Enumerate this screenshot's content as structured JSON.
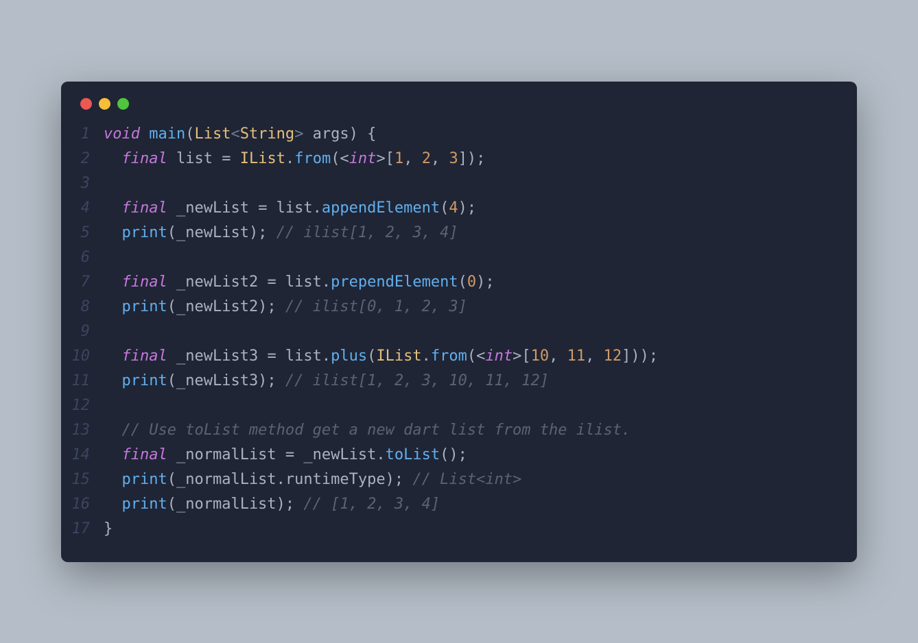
{
  "traffic_lights": {
    "red": "#ed5754",
    "yellow": "#f5bf3a",
    "green": "#4fc53e"
  },
  "code": {
    "lines": [
      {
        "n": "1",
        "tokens": [
          {
            "c": "kw-void",
            "t": "void"
          },
          {
            "c": "punct",
            "t": " "
          },
          {
            "c": "fn-main",
            "t": "main"
          },
          {
            "c": "punct",
            "t": "("
          },
          {
            "c": "type",
            "t": "List"
          },
          {
            "c": "punct-dim",
            "t": "<"
          },
          {
            "c": "type",
            "t": "String"
          },
          {
            "c": "punct-dim",
            "t": ">"
          },
          {
            "c": "ident",
            "t": " args"
          },
          {
            "c": "punct",
            "t": ") {"
          }
        ]
      },
      {
        "n": "2",
        "tokens": [
          {
            "c": "punct",
            "t": "  "
          },
          {
            "c": "kw-final",
            "t": "final"
          },
          {
            "c": "ident",
            "t": " list "
          },
          {
            "c": "punct",
            "t": "="
          },
          {
            "c": "ident",
            "t": " "
          },
          {
            "c": "type",
            "t": "IList"
          },
          {
            "c": "punct",
            "t": "."
          },
          {
            "c": "method",
            "t": "from"
          },
          {
            "c": "punct",
            "t": "(<"
          },
          {
            "c": "kw-int",
            "t": "int"
          },
          {
            "c": "punct",
            "t": ">["
          },
          {
            "c": "num",
            "t": "1"
          },
          {
            "c": "punct",
            "t": ", "
          },
          {
            "c": "num",
            "t": "2"
          },
          {
            "c": "punct",
            "t": ", "
          },
          {
            "c": "num",
            "t": "3"
          },
          {
            "c": "punct",
            "t": "]);"
          }
        ]
      },
      {
        "n": "3",
        "tokens": []
      },
      {
        "n": "4",
        "tokens": [
          {
            "c": "punct",
            "t": "  "
          },
          {
            "c": "kw-final",
            "t": "final"
          },
          {
            "c": "ident",
            "t": " _newList "
          },
          {
            "c": "punct",
            "t": "="
          },
          {
            "c": "ident",
            "t": " list."
          },
          {
            "c": "method",
            "t": "appendElement"
          },
          {
            "c": "punct",
            "t": "("
          },
          {
            "c": "num",
            "t": "4"
          },
          {
            "c": "punct",
            "t": ");"
          }
        ]
      },
      {
        "n": "5",
        "tokens": [
          {
            "c": "punct",
            "t": "  "
          },
          {
            "c": "call",
            "t": "print"
          },
          {
            "c": "punct",
            "t": "(_newList); "
          },
          {
            "c": "comment",
            "t": "// ilist[1, 2, 3, 4]"
          }
        ]
      },
      {
        "n": "6",
        "tokens": []
      },
      {
        "n": "7",
        "tokens": [
          {
            "c": "punct",
            "t": "  "
          },
          {
            "c": "kw-final",
            "t": "final"
          },
          {
            "c": "ident",
            "t": " _newList2 "
          },
          {
            "c": "punct",
            "t": "="
          },
          {
            "c": "ident",
            "t": " list."
          },
          {
            "c": "method",
            "t": "prependElement"
          },
          {
            "c": "punct",
            "t": "("
          },
          {
            "c": "num",
            "t": "0"
          },
          {
            "c": "punct",
            "t": ");"
          }
        ]
      },
      {
        "n": "8",
        "tokens": [
          {
            "c": "punct",
            "t": "  "
          },
          {
            "c": "call",
            "t": "print"
          },
          {
            "c": "punct",
            "t": "(_newList2); "
          },
          {
            "c": "comment",
            "t": "// ilist[0, 1, 2, 3]"
          }
        ]
      },
      {
        "n": "9",
        "tokens": []
      },
      {
        "n": "10",
        "tokens": [
          {
            "c": "punct",
            "t": "  "
          },
          {
            "c": "kw-final",
            "t": "final"
          },
          {
            "c": "ident",
            "t": " _newList3 "
          },
          {
            "c": "punct",
            "t": "="
          },
          {
            "c": "ident",
            "t": " list."
          },
          {
            "c": "method",
            "t": "plus"
          },
          {
            "c": "punct",
            "t": "("
          },
          {
            "c": "type",
            "t": "IList"
          },
          {
            "c": "punct",
            "t": "."
          },
          {
            "c": "method",
            "t": "from"
          },
          {
            "c": "punct",
            "t": "(<"
          },
          {
            "c": "kw-int",
            "t": "int"
          },
          {
            "c": "punct",
            "t": ">["
          },
          {
            "c": "num",
            "t": "10"
          },
          {
            "c": "punct",
            "t": ", "
          },
          {
            "c": "num",
            "t": "11"
          },
          {
            "c": "punct",
            "t": ", "
          },
          {
            "c": "num",
            "t": "12"
          },
          {
            "c": "punct",
            "t": "]));"
          }
        ]
      },
      {
        "n": "11",
        "tokens": [
          {
            "c": "punct",
            "t": "  "
          },
          {
            "c": "call",
            "t": "print"
          },
          {
            "c": "punct",
            "t": "(_newList3); "
          },
          {
            "c": "comment",
            "t": "// ilist[1, 2, 3, 10, 11, 12]"
          }
        ]
      },
      {
        "n": "12",
        "tokens": []
      },
      {
        "n": "13",
        "tokens": [
          {
            "c": "punct",
            "t": "  "
          },
          {
            "c": "comment",
            "t": "// Use toList method get a new dart list from the ilist."
          }
        ]
      },
      {
        "n": "14",
        "tokens": [
          {
            "c": "punct",
            "t": "  "
          },
          {
            "c": "kw-final",
            "t": "final"
          },
          {
            "c": "ident",
            "t": " _normalList "
          },
          {
            "c": "punct",
            "t": "="
          },
          {
            "c": "ident",
            "t": " _newList."
          },
          {
            "c": "method",
            "t": "toList"
          },
          {
            "c": "punct",
            "t": "();"
          }
        ]
      },
      {
        "n": "15",
        "tokens": [
          {
            "c": "punct",
            "t": "  "
          },
          {
            "c": "call",
            "t": "print"
          },
          {
            "c": "punct",
            "t": "(_normalList.runtimeType); "
          },
          {
            "c": "comment",
            "t": "// List<int>"
          }
        ]
      },
      {
        "n": "16",
        "tokens": [
          {
            "c": "punct",
            "t": "  "
          },
          {
            "c": "call",
            "t": "print"
          },
          {
            "c": "punct",
            "t": "(_normalList); "
          },
          {
            "c": "comment",
            "t": "// [1, 2, 3, 4]"
          }
        ]
      },
      {
        "n": "17",
        "tokens": [
          {
            "c": "punct",
            "t": "}"
          }
        ]
      }
    ]
  }
}
